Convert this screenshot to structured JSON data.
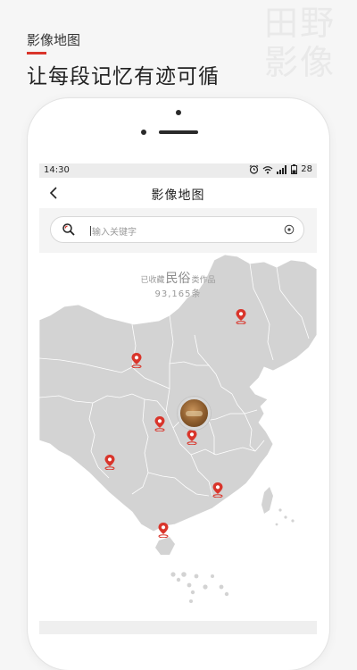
{
  "promo": {
    "caption": "影像地图",
    "slogan": "让每段记忆有迹可循",
    "watermark_line1": "田野",
    "watermark_line2": "影像",
    "accent_color": "#d9352b"
  },
  "status_bar": {
    "time": "14:30",
    "battery": "28",
    "icons": [
      "alarm-icon",
      "wifi-icon",
      "signal-icon",
      "battery-icon"
    ]
  },
  "nav": {
    "back_icon": "chevron-left-icon",
    "title": "影像地图"
  },
  "search": {
    "placeholder": "输入关键字",
    "search_icon": "search-icon",
    "clear_icon": "clear-icon"
  },
  "map": {
    "collected_prefix": "已收藏",
    "collected_category": "民俗",
    "collected_suffix": "类作品",
    "collected_count": "93,165条",
    "region_fill": "#d3d3d3",
    "border_color": "#ffffff",
    "pin_color": "#d9352b",
    "markers": [
      "location-pin-icon",
      "location-pin-icon",
      "location-pin-icon",
      "location-pin-icon",
      "location-pin-icon",
      "location-pin-icon",
      "location-pin-icon",
      "location-pin-icon"
    ]
  }
}
